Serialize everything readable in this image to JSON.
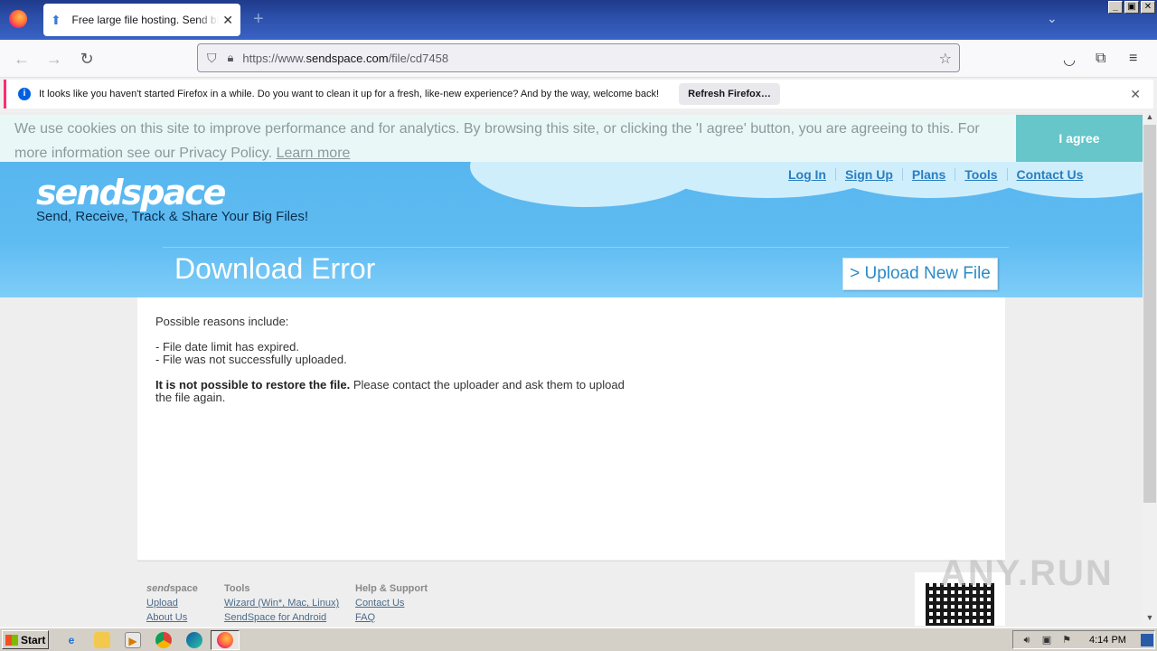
{
  "browser": {
    "tab_title": "Free large file hosting. Send big fil",
    "tab_close": "✕",
    "new_tab": "+",
    "url_prefix": "https://www.",
    "url_domain": "sendspace.com",
    "url_path": "/file/cd7458"
  },
  "notification": {
    "text": "It looks like you haven't started Firefox in a while. Do you want to clean it up for a fresh, like-new experience? And by the way, welcome back!",
    "button": "Refresh Firefox…",
    "close": "✕"
  },
  "cookie": {
    "text": "We use cookies on this site to improve performance and for analytics. By browsing this site, or clicking the 'I agree' button, you are agreeing to this. For more information see our Privacy Policy.",
    "link": "Learn more",
    "button": "I agree"
  },
  "site": {
    "logo": "sendspace",
    "tagline": "Send, Receive, Track & Share Your Big Files!",
    "nav": [
      "Log In",
      "Sign Up",
      "Plans",
      "Tools",
      "Contact Us"
    ],
    "page_title": "Download Error",
    "upload_button": "> Upload New File"
  },
  "error": {
    "intro": "Possible reasons include:",
    "reason1": "- File date limit has expired.",
    "reason2": "- File was not successfully uploaded.",
    "restore_bold": "It is not possible to restore the file.",
    "restore_rest": " Please contact the uploader and ask them to upload the file again."
  },
  "footer": {
    "col1_head_italic": "send",
    "col1_head": "space",
    "col1_links": [
      "Upload",
      "About Us"
    ],
    "col2_head": "Tools",
    "col2_links": [
      "Wizard (Win*, Mac, Linux)",
      "SendSpace for Android"
    ],
    "col3_head": "Help & Support",
    "col3_links": [
      "Contact Us",
      "FAQ"
    ]
  },
  "watermark": "ANY.RUN",
  "taskbar": {
    "start": "Start",
    "clock": "4:14 PM"
  }
}
